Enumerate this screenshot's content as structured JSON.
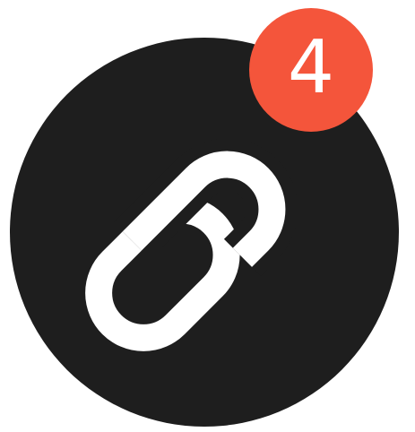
{
  "icon": {
    "name": "link-icon",
    "background_color": "#1e1e1e",
    "glyph_color": "#ffffff"
  },
  "badge": {
    "count": "4",
    "color": "#f4553b"
  }
}
